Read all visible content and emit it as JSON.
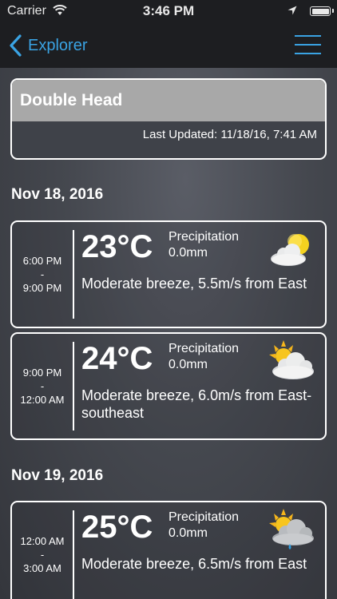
{
  "status_bar": {
    "carrier": "Carrier",
    "time": "3:46 PM",
    "battery_level": 1.0
  },
  "nav": {
    "back_label": "Explorer"
  },
  "location": {
    "name": "Double Head",
    "last_updated": "Last Updated: 11/18/16, 7:41 AM"
  },
  "days": [
    {
      "date": "Nov 18, 2016",
      "forecasts": [
        {
          "time_start": "6:00 PM",
          "time_sep": "-",
          "time_end": "9:00 PM",
          "temperature": "23°C",
          "precip_label": "Precipitation",
          "precip_value": "0.0mm",
          "wind": "Moderate breeze, 5.5m/s from East",
          "icon": "partly-cloudy-night-icon"
        },
        {
          "time_start": "9:00 PM",
          "time_sep": "-",
          "time_end": "12:00 AM",
          "temperature": "24°C",
          "precip_label": "Precipitation",
          "precip_value": "0.0mm",
          "wind": "Moderate breeze, 6.0m/s from East-southeast",
          "icon": "partly-cloudy-day-icon"
        }
      ]
    },
    {
      "date": "Nov 19, 2016",
      "forecasts": [
        {
          "time_start": "12:00 AM",
          "time_sep": "-",
          "time_end": "3:00 AM",
          "temperature": "25°C",
          "precip_label": "Precipitation",
          "precip_value": "0.0mm",
          "wind": "Moderate breeze, 6.5m/s from East",
          "icon": "light-rain-sun-icon"
        }
      ]
    }
  ],
  "colors": {
    "accent": "#3aa3e3",
    "bar_background": "#1d1e21",
    "title_band": "#a8a8a8"
  }
}
